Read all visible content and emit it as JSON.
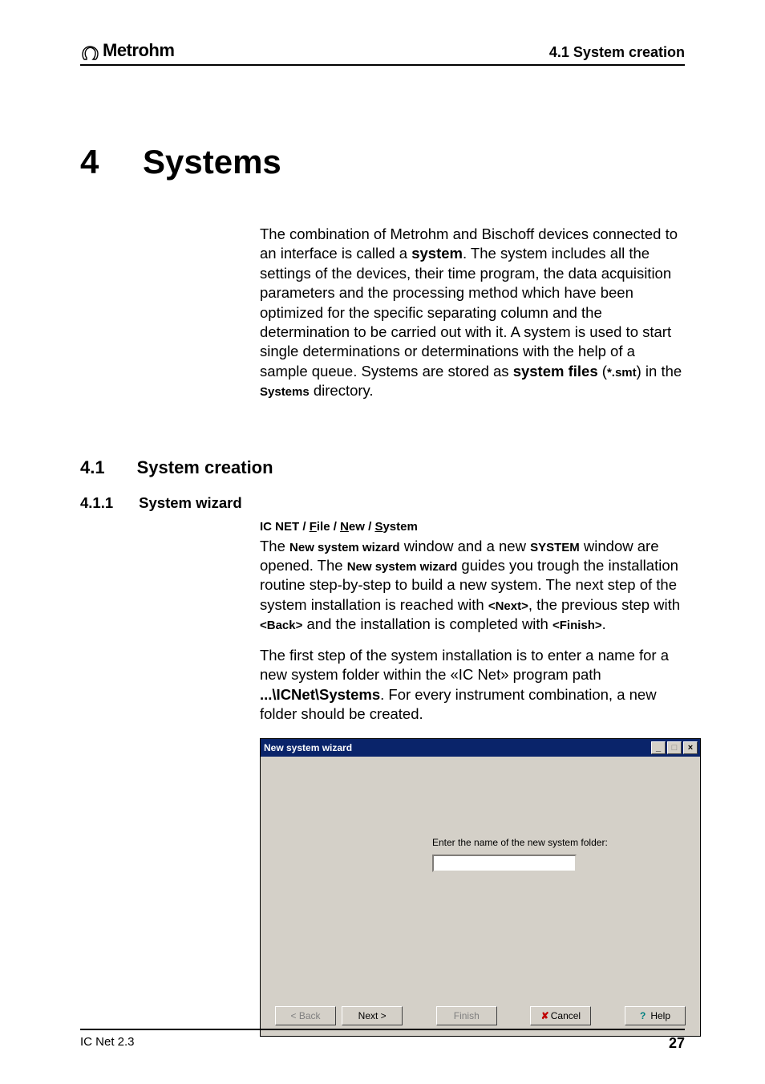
{
  "header": {
    "brand": "Metrohm",
    "section": "4.1  System creation"
  },
  "chapter": {
    "number": "4",
    "title": "Systems"
  },
  "intro": {
    "pre1": "The combination of Metrohm and Bischoff devices connected to an interface is called a ",
    "b1": "system",
    "post1": ". The system includes all the settings of the devices, their time program, the data acquisition parameters and the processing method which have been optimized for the specific separating column and the determination to be carried out with it. A system is used to start single determinations or determinations with the help of a sample queue. Systems are stored as ",
    "b2": "system files",
    "post2": " (",
    "sb1": "*.smt",
    "post3": ") in the ",
    "sb2": "Systems",
    "post4": " directory."
  },
  "section41": {
    "num": "4.1",
    "title": "System creation"
  },
  "section411": {
    "num": "4.1.1",
    "title": "System wizard"
  },
  "menupath": {
    "p1": "IC NET",
    "sep": " / ",
    "file_u": "F",
    "file_rest": "ile",
    "new_u": "N",
    "new_rest": "ew",
    "sys_u": "S",
    "sys_rest": "ystem"
  },
  "para1": {
    "t1": "The ",
    "b1": "New system wizard",
    "t2": " window and a new ",
    "b2": "SYSTEM",
    "t3": " window are opened. The ",
    "b3": "New system wizard",
    "t4": " guides you trough the installation routine step-by-step to build a new system. The next step of the system installation is reached with ",
    "b4": "<Next>",
    "t5": ", the previous step with ",
    "b5": "<Back>",
    "t6": " and the installation is completed with ",
    "b6": "<Finish>",
    "t7": "."
  },
  "para2": {
    "t1": "The first step of the system installation is to enter a name for a new system folder within the «IC Net» program path ",
    "b1": "...\\ICNet\\Systems",
    "t2": ". For every instrument combination, a new folder should be created."
  },
  "wizard": {
    "title": "New system wizard",
    "minimize": "_",
    "maximize": "□",
    "close": "×",
    "prompt": "Enter the name of the new system folder:",
    "input_value": "",
    "buttons": {
      "back": "< Back",
      "next": "Next >",
      "finish": "Finish",
      "cancel": "Cancel",
      "help": "Help"
    }
  },
  "footer": {
    "left": "IC Net 2.3",
    "page": "27"
  }
}
